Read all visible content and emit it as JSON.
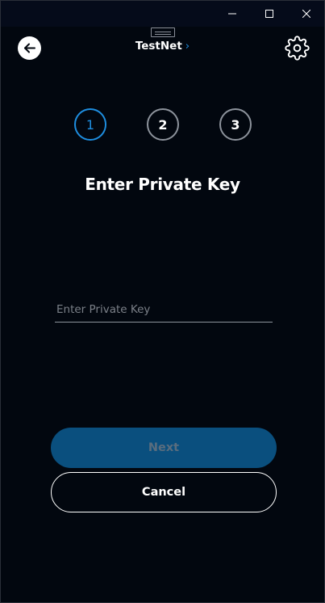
{
  "window": {
    "controls": [
      "minimize",
      "maximize",
      "close"
    ]
  },
  "header": {
    "network_label": "TestNet",
    "network_chevron": "›",
    "back_icon": "arrow-left-icon",
    "settings_icon": "gear-icon"
  },
  "stepper": {
    "steps": [
      "1",
      "2",
      "3"
    ],
    "active_step": 1
  },
  "main": {
    "heading": "Enter Private Key",
    "input_placeholder": "Enter Private Key",
    "input_value": ""
  },
  "actions": {
    "next_label": "Next",
    "cancel_label": "Cancel"
  },
  "colors": {
    "background": "#02070f",
    "accent": "#1e8ee0",
    "next_button": "#0a4f7e",
    "next_text_disabled": "#5a6d7e",
    "step_border": "#8d939c"
  }
}
